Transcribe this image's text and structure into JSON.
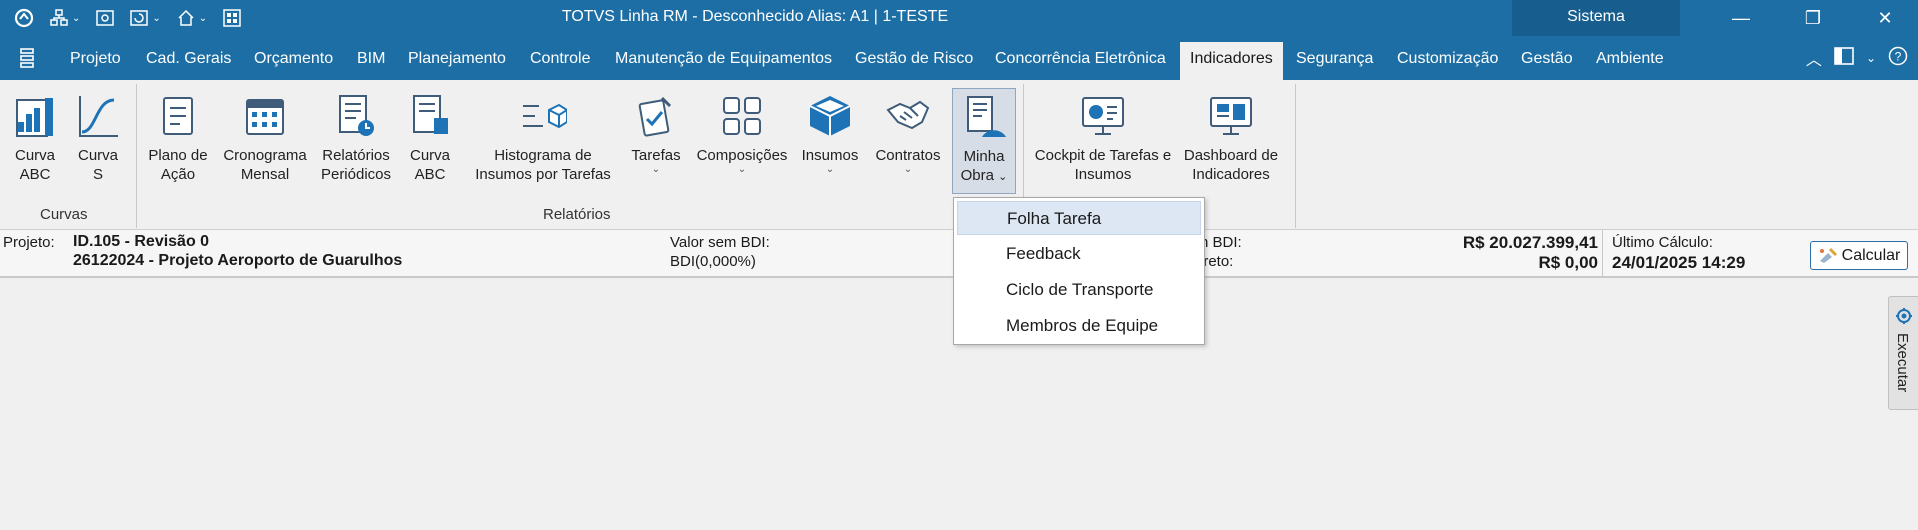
{
  "titlebar": {
    "title": "TOTVS Linha RM - Desconhecido  Alias: A1 | 1-TESTE",
    "sistema": "Sistema"
  },
  "menu": {
    "items": [
      {
        "label": "Projeto"
      },
      {
        "label": "Cad. Gerais"
      },
      {
        "label": "Orçamento"
      },
      {
        "label": "BIM"
      },
      {
        "label": "Planejamento"
      },
      {
        "label": "Controle"
      },
      {
        "label": "Manutenção de Equipamentos"
      },
      {
        "label": "Gestão de Risco"
      },
      {
        "label": "Concorrência Eletrônica"
      },
      {
        "label": "Indicadores"
      },
      {
        "label": "Segurança"
      },
      {
        "label": "Customização"
      },
      {
        "label": "Gestão"
      },
      {
        "label": "Ambiente"
      }
    ],
    "active": "Indicadores"
  },
  "ribbon": {
    "groups": {
      "curvas": "Curvas",
      "relatorios": "Relatórios"
    },
    "buttons": {
      "curva_abc": "Curva ABC",
      "curva_s": "Curva S",
      "plano_acao": "Plano de Ação",
      "cronograma_mensal": "Cronograma Mensal",
      "relatorios_periodicos": "Relatórios Periódicos",
      "curva_abc2": "Curva ABC",
      "histograma": "Histograma de Insumos por Tarefas",
      "tarefas": "Tarefas",
      "composicoes": "Composições",
      "insumos": "Insumos",
      "contratos": "Contratos",
      "minha_obra": "Minha Obra",
      "cockpit": "Cockpit de Tarefas e Insumos",
      "dashboard": "Dashboard de Indicadores"
    }
  },
  "info": {
    "projeto_label": "Projeto:",
    "projeto_id": "ID.105 - Revisão 0",
    "projeto_nome": "26122024 - Projeto Aeroporto de Guarulhos",
    "valor_sem_bdi_label": "Valor sem BDI:",
    "bdi_label": "BDI(0,000%)",
    "com_bdi_label_partial": "n BDI:",
    "direto_label_partial": "ireto:",
    "valor_com_bdi": "R$ 20.027.399,41",
    "valor_direto": "R$ 0,00",
    "ultimo_calculo_label": "Último Cálculo:",
    "ultimo_calculo_value": "24/01/2025 14:29",
    "calcular": "Calcular"
  },
  "dropdown": {
    "items": [
      "Folha Tarefa",
      "Feedback",
      "Ciclo de Transporte",
      "Membros de Equipe"
    ],
    "highlighted": "Folha Tarefa"
  },
  "side_panel": {
    "label": "Executar"
  },
  "colors": {
    "titlebar": "#1c6ea4",
    "sistema": "#175d8d",
    "ribbon_bg": "#f0f0f0",
    "accent_icon": "#1d73b6"
  }
}
